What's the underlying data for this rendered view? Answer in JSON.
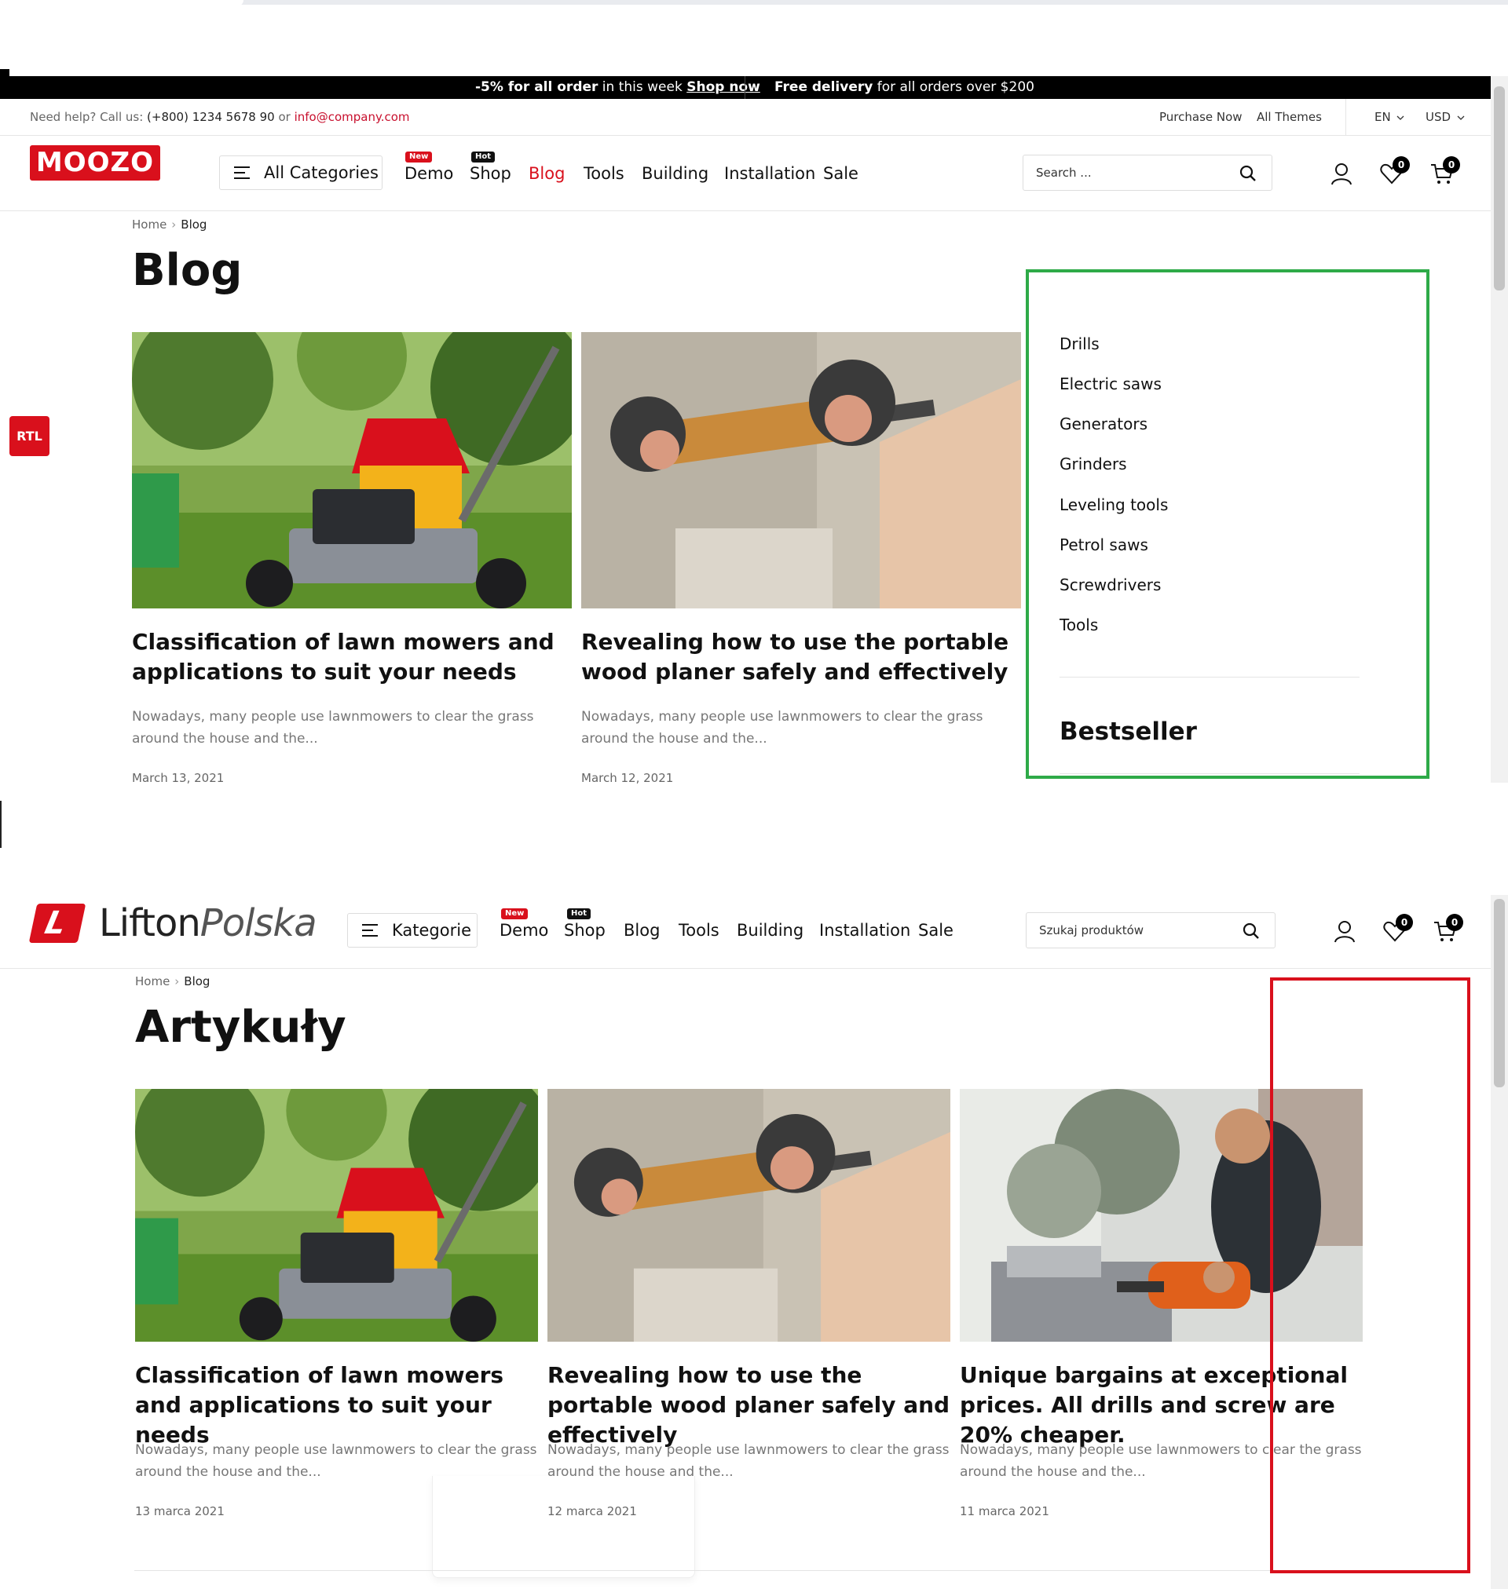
{
  "top": {
    "promo_left_bold": "-5% for all order",
    "promo_left_text": " in this week ",
    "promo_left_link": "Shop now",
    "promo_right_bold": "Free delivery",
    "promo_right_text": " for all orders over $200",
    "help_text": "Need help? Call us: ",
    "phone": "(+800) 1234 5678 90",
    "or_text": " or ",
    "email": "info@company.com",
    "purchase_now": "Purchase Now",
    "all_themes": "All Themes",
    "language": "EN",
    "currency": "USD",
    "logo": "MOOZO",
    "categories_label": "All Categories",
    "nav": [
      "Demo",
      "Shop",
      "Blog",
      "Tools",
      "Building",
      "Installation",
      "Sale"
    ],
    "badge_new": "New",
    "badge_hot": "Hot",
    "search_placeholder": "Search ...",
    "wishlist_count": "0",
    "cart_count": "0",
    "breadcrumb_home": "Home",
    "breadcrumb_current": "Blog",
    "page_title": "Blog",
    "rtl_label": "RTL",
    "posts": [
      {
        "title": "Classification of lawn mowers and applications to suit your needs",
        "excerpt": "Nowadays, many people use lawnmowers to clear the grass around the house and the...",
        "date": "March 13, 2021"
      },
      {
        "title": "Revealing how to use the portable wood planer safely and effectively",
        "excerpt": "Nowadays, many people use lawnmowers to clear the grass around the house and the...",
        "date": "March 12, 2021"
      }
    ],
    "sidebar_categories": [
      "Drills",
      "Electric saws",
      "Generators",
      "Grinders",
      "Leveling tools",
      "Petrol saws",
      "Screwdrivers",
      "Tools"
    ],
    "sidebar_heading": "Bestseller"
  },
  "bottom": {
    "logo_main": "Lifton",
    "logo_light": "Polska",
    "categories_label": "Kategorie",
    "nav": [
      "Demo",
      "Shop",
      "Blog",
      "Tools",
      "Building",
      "Installation",
      "Sale"
    ],
    "badge_new": "New",
    "badge_hot": "Hot",
    "search_placeholder": "Szukaj produktów",
    "wishlist_count": "0",
    "cart_count": "0",
    "breadcrumb_home": "Home",
    "breadcrumb_current": "Blog",
    "page_title": "Artykuły",
    "posts": [
      {
        "title": "Classification of lawn mowers and applications to suit your needs",
        "excerpt": "Nowadays, many people use lawnmowers to clear the grass around the house and the...",
        "date": "13 marca 2021"
      },
      {
        "title": "Revealing how to use the portable wood planer safely and effectively",
        "excerpt": "Nowadays, many people use lawnmowers to clear the grass around the house and the...",
        "date": "12 marca 2021"
      },
      {
        "title": "Unique bargains at exceptional prices. All drills and screw are 20% cheaper.",
        "excerpt": "Nowadays, many people use lawnmowers to clear the grass around the house and the...",
        "date": "11 marca 2021"
      }
    ]
  },
  "colors": {
    "brand_red": "#d9101c",
    "highlight_green": "#2eaa48",
    "highlight_red": "#d9101c"
  },
  "icons": [
    "menu-icon",
    "search-icon",
    "user-icon",
    "heart-icon",
    "cart-icon",
    "chevron-down-icon"
  ]
}
